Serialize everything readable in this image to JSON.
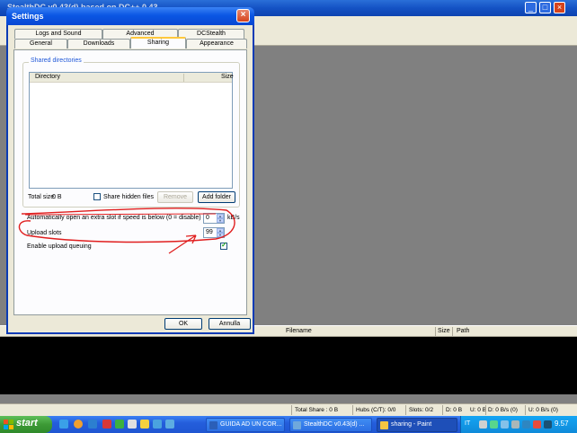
{
  "background_app": {
    "title": "StealthDC v0.43(d) based on DC++ 0.43",
    "results_columns": [
      "Filename",
      "Size",
      "Path"
    ],
    "status_bar": [
      "Total Share : 0 B",
      "Hubs (C/T): 0/0",
      "Slots: 0/2",
      "D: 0 B",
      "U: 0 B",
      "D: 0 B/s (0)",
      "U: 0 B/s (0)"
    ]
  },
  "dialog": {
    "title": "Settings",
    "tabs_back_row": [
      "Logs and Sound",
      "Advanced",
      "DCStealth"
    ],
    "tabs_front_row": [
      "General",
      "Downloads",
      "Sharing",
      "Appearance"
    ],
    "selected_tab": "Sharing",
    "shared_directories": {
      "group_label": "Shared directories",
      "columns": [
        "Directory",
        "Size"
      ],
      "rows": []
    },
    "total_size_label": "Total size:",
    "total_size_value": "0 B",
    "share_hidden_label": "Share hidden files",
    "remove_label": "Remove",
    "add_folder_label": "Add folder",
    "extra_slot_label": "Automatically open an extra slot if speed is below (0 = disable)",
    "extra_slot_value": "0",
    "extra_slot_unit": "kB/s",
    "upload_slots_label": "Upload slots",
    "upload_slots_value": "99",
    "enable_queue_label": "Enable upload queuing",
    "enable_queue_checked": true,
    "ok_label": "OK",
    "cancel_label": "Annulla"
  },
  "taskbar": {
    "start_label": "start",
    "tasks": [
      "GUIDA AD UN COR...",
      "StealthDC v0.43(d) ...",
      "sharing - Paint"
    ],
    "language": "IT",
    "clock": "9.57"
  },
  "colors": {
    "annotation": "#e01e1e",
    "title_blue": "#0b57e4",
    "taskbar_blue": "#245edc",
    "start_green": "#3d9a36"
  }
}
